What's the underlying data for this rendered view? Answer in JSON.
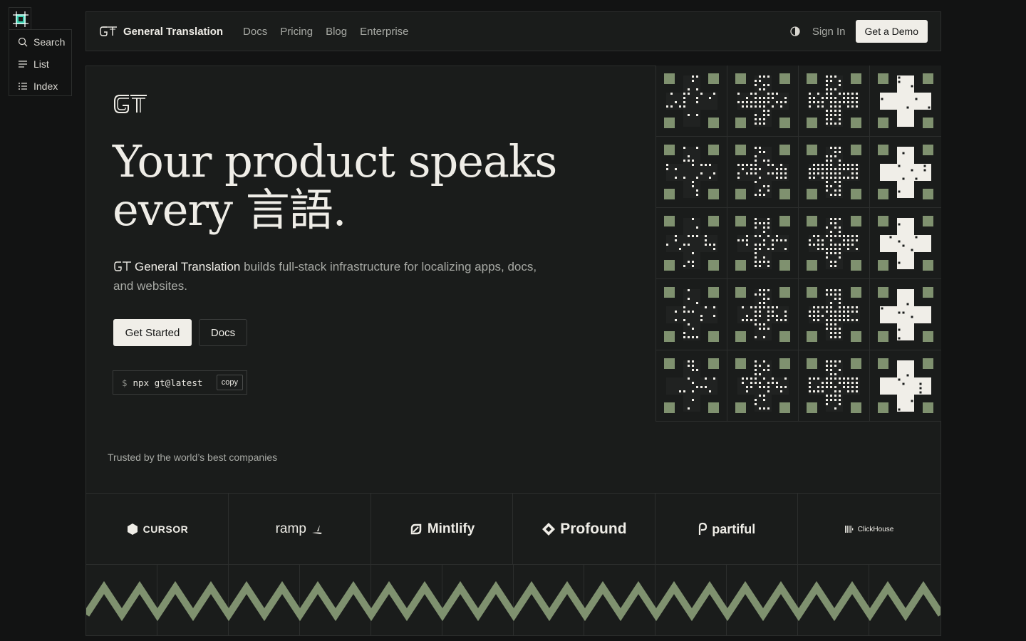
{
  "toolbar": {
    "items": [
      {
        "label": "Search",
        "icon": "search-icon"
      },
      {
        "label": "List",
        "icon": "list-icon"
      },
      {
        "label": "Index",
        "icon": "index-icon"
      }
    ]
  },
  "nav": {
    "brand": "General Translation",
    "links": [
      "Docs",
      "Pricing",
      "Blog",
      "Enterprise"
    ],
    "sign_in": "Sign In",
    "demo": "Get a Demo"
  },
  "hero": {
    "title_line1": "Your product speaks",
    "title_line2": "every 言語.",
    "desc_brand": "General Translation",
    "desc_rest": " builds full-stack infrastructure for localizing apps, docs, and websites.",
    "primary_button": "Get Started",
    "secondary_button": "Docs",
    "command_prompt": "$",
    "command": "npx gt@latest",
    "copy_label": "copy"
  },
  "trusted": {
    "label": "Trusted by the world’s best companies",
    "companies": [
      "CURSOR",
      "ramp",
      "Mintlify",
      "Profound",
      "partiful",
      "ClickHouse"
    ]
  },
  "colors": {
    "background": "#121313",
    "panel": "#1a1c1b",
    "accent_green": "#7f916f",
    "text": "#efede7",
    "muted": "#a7a9a4"
  }
}
